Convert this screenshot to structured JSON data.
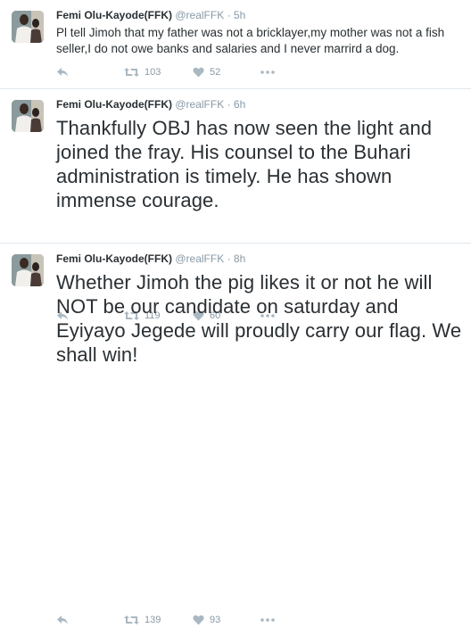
{
  "tweets": [
    {
      "name": "Femi Olu-Kayode(FFK)",
      "handle": "@realFFK",
      "dot": "·",
      "time": "5h",
      "text": "Pl tell Jimoh that my father was not a bricklayer,my mother was not a fish seller,I do not owe banks and salaries and I never marrird a dog.",
      "retweets": "103",
      "likes": "52"
    },
    {
      "name": "Femi Olu-Kayode(FFK)",
      "handle": "@realFFK",
      "dot": "·",
      "time": "6h",
      "text": "Thankfully OBJ has now seen the light and joined the fray. His counsel to the Buhari administration is timely. He has shown immense courage.",
      "retweets": "119",
      "likes": "60"
    },
    {
      "name": "Femi Olu-Kayode(FFK)",
      "handle": "@realFFK",
      "dot": "·",
      "time": "8h",
      "text": "Whether Jimoh the pig likes it or not he will NOT be our candidate on saturday and Eyiyayo Jegede will proudly carry our flag. We shall win!",
      "retweets": "139",
      "likes": "93"
    }
  ],
  "icons": {
    "reply": "reply-icon",
    "retweet": "retweet-icon",
    "like": "heart-icon",
    "more": "more-dots-icon"
  },
  "colors": {
    "icon": "#aab8c2",
    "meta": "#8899a6",
    "divider": "#e1e8ed"
  }
}
